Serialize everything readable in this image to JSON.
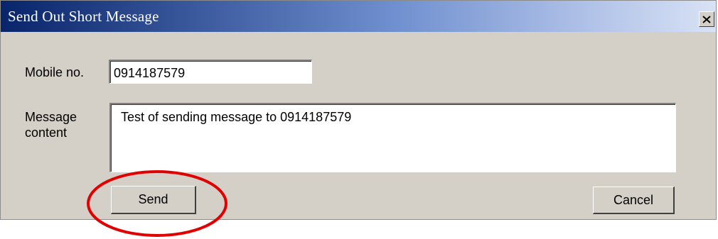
{
  "window": {
    "title": "Send Out Short Message",
    "close_icon": "close-icon"
  },
  "form": {
    "mobile_label": "Mobile no.",
    "mobile_value": "0914187579",
    "message_label": "Message content",
    "message_value": "Test of sending message to 0914187579"
  },
  "buttons": {
    "send_label": "Send",
    "cancel_label": "Cancel"
  },
  "annotation": {
    "highlight_color": "#e00000",
    "highlighted_element": "send-button"
  }
}
